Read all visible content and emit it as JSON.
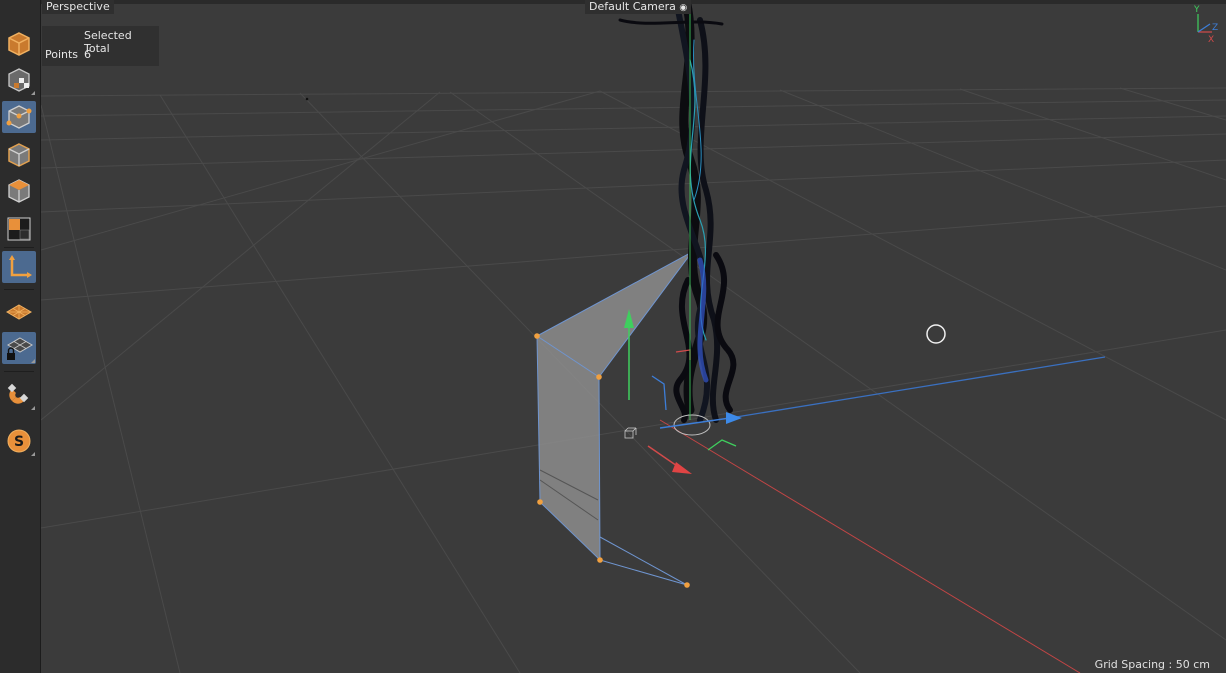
{
  "viewport": {
    "view_name": "Perspective",
    "camera_name": "Default Camera",
    "grid_spacing_label": "Grid Spacing :",
    "grid_spacing_value": "50 cm"
  },
  "stats": {
    "header": "Selected Total",
    "row_label": "Points",
    "row_value": "6"
  },
  "toolbar": {
    "items": [
      {
        "icon": "model-mode-icon"
      },
      {
        "icon": "texture-mode-icon"
      },
      {
        "icon": "points-mode-icon",
        "active": true
      },
      {
        "icon": "edges-mode-icon"
      },
      {
        "icon": "polygons-mode-icon"
      },
      {
        "icon": "uv-mode-icon"
      },
      {
        "icon": "axis-mode-icon",
        "active": true
      },
      {
        "icon": "workplane-icon"
      },
      {
        "icon": "locked-workplane-icon",
        "active": true
      },
      {
        "icon": "magnet-icon"
      },
      {
        "icon": "snap-icon"
      }
    ]
  },
  "axis_gizmo": {
    "labels": [
      "Y",
      "Z",
      "X"
    ]
  },
  "colors": {
    "background": "#3b3b3b",
    "grid": "#4b4b4b",
    "x_axis": "#d24a4a",
    "y_axis": "#3fcf5e",
    "z_axis": "#3d7ed8",
    "selected_point": "#f0a040",
    "accent": "#4c6a90"
  }
}
